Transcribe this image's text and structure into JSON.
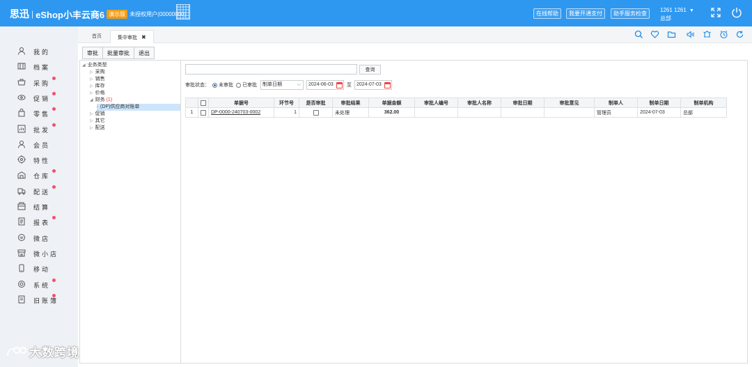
{
  "header": {
    "logo": "思迅",
    "product": "eShop小丰云商6",
    "edition_badge": "演示版",
    "license": "未授权用户(00000000)",
    "buttons": {
      "help": "在线帮助",
      "pay": "我要开通支付",
      "check": "助手服务检查"
    },
    "account": {
      "line1": "1261 1261",
      "line2": "总部",
      "caret": "▼"
    },
    "icons": [
      "expand-icon",
      "power-icon"
    ],
    "colors": {
      "bar": "#2e97f0",
      "badge": "#f39c12"
    }
  },
  "sidebar": {
    "items": [
      {
        "label": "我的",
        "icon": "user-icon",
        "dot": false
      },
      {
        "label": "档案",
        "icon": "archive-icon",
        "dot": false
      },
      {
        "label": "采购",
        "icon": "cart-icon",
        "dot": true
      },
      {
        "label": "促销",
        "icon": "eye-icon",
        "dot": true
      },
      {
        "label": "零售",
        "icon": "bag-icon",
        "dot": true
      },
      {
        "label": "批发",
        "icon": "chart-icon",
        "dot": true
      },
      {
        "label": "会员",
        "icon": "member-icon",
        "dot": false
      },
      {
        "label": "特性",
        "icon": "target-icon",
        "dot": false
      },
      {
        "label": "仓库",
        "icon": "warehouse-icon",
        "dot": true
      },
      {
        "label": "配送",
        "icon": "truck-icon",
        "dot": true
      },
      {
        "label": "结算",
        "icon": "wallet-icon",
        "dot": false
      },
      {
        "label": "报表",
        "icon": "report-icon",
        "dot": true
      },
      {
        "label": "微店",
        "icon": "wechat-shop-icon",
        "dot": false
      },
      {
        "label": "微小店",
        "icon": "store-icon",
        "dot": false
      },
      {
        "label": "移动",
        "icon": "mobile-icon",
        "dot": false
      },
      {
        "label": "系统",
        "icon": "settings-icon",
        "dot": true
      },
      {
        "label": "旧账簿",
        "icon": "ledger-icon",
        "dot": true
      }
    ],
    "dot_color": "#f0506e"
  },
  "tabs": [
    {
      "label": "首页"
    },
    {
      "label": "集中审批",
      "close": "✖"
    }
  ],
  "tab_icons": [
    "search-icon",
    "heart-icon",
    "folder-icon",
    "speaker-icon",
    "alarm-icon",
    "clock-icon",
    "refresh-icon"
  ],
  "toolbar": {
    "approve": "审批",
    "batch": "批量审批",
    "exit": "退出"
  },
  "tree": {
    "root": "业务类型",
    "nodes": [
      "采购",
      "销售",
      "库存",
      "价格"
    ],
    "finance": {
      "label": "财务",
      "count": "(1)"
    },
    "finance_child": "(DP)供应商对账单",
    "more": [
      "促销",
      "其它",
      "配送"
    ]
  },
  "search": {
    "value": "",
    "button": "查询"
  },
  "filter": {
    "label": "审批状态：",
    "unapproved": "未审批",
    "approved": "已审批",
    "date_type": "制单日期",
    "date_from": "2024-06-03",
    "to": "至",
    "date_to": "2024-07-03"
  },
  "grid": {
    "headers": [
      "单据号",
      "环节号",
      "是否审批",
      "审批结果",
      "单据金额",
      "审批人编号",
      "审批人名称",
      "审批日期",
      "审批意见",
      "制单人",
      "制单日期",
      "制单机构"
    ],
    "rows": [
      {
        "no": "1",
        "doc": "DP-0000-240703-0002",
        "step": "1",
        "result": "未处理",
        "amount": "362.00",
        "approver_no": "",
        "approver_name": "",
        "approve_date": "",
        "opinion": "",
        "creator": "管理员",
        "create_date": "2024-07-03",
        "org": "总部"
      }
    ]
  },
  "watermark": "大数跨境"
}
